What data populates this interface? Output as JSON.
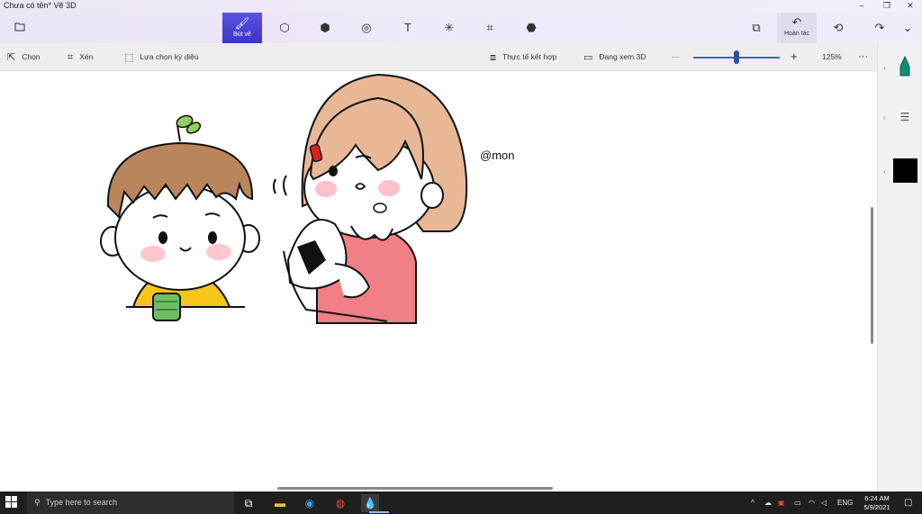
{
  "window": {
    "title": "Chưa có tên*   Vẽ 3D",
    "minimize_glyph": "–",
    "restore_glyph": "❐",
    "close_glyph": "✕"
  },
  "toolbar": {
    "menu_icon": "folder-icon",
    "tools": [
      {
        "name": "brushes",
        "label": "Bút vẽ",
        "icon": "brush-icon",
        "glyph": "🖌",
        "active": true
      },
      {
        "name": "2d-shapes",
        "icon": "shapes-2d-icon",
        "glyph": "⬡"
      },
      {
        "name": "3d-shapes",
        "icon": "cube-icon",
        "glyph": "⬢"
      },
      {
        "name": "stickers",
        "icon": "sticker-icon",
        "glyph": "◎"
      },
      {
        "name": "text",
        "icon": "text-icon",
        "glyph": "T"
      },
      {
        "name": "effects",
        "icon": "effects-icon",
        "glyph": "✳"
      },
      {
        "name": "canvas",
        "icon": "canvas-icon",
        "glyph": "⌗"
      },
      {
        "name": "3d-library",
        "icon": "3d-library-icon",
        "glyph": "⬣"
      }
    ],
    "paste_glyph": "⧉",
    "undo_label": "Hoàn tác",
    "undo_glyph": "↶",
    "history_glyph": "⟲",
    "redo_glyph": "↷",
    "more_glyph": "⌄"
  },
  "subbar": {
    "select_label": "Chọn",
    "crop_label": "Xén",
    "magic_select_label": "Lựa chọn kỳ diệu",
    "mixed_reality_label": "Thực tế kết hợp",
    "view3d_label": "Đang xem 3D",
    "zoom_minus": "—",
    "zoom_plus": "+",
    "zoom_value": "125%",
    "zoom_fraction": 0.45,
    "more": "···"
  },
  "canvas": {
    "watermark": "@mon"
  },
  "rightpanel": {
    "marker_color": "#0f8e75",
    "current_color": "#000000"
  },
  "taskbar": {
    "search_placeholder": "Type here to search",
    "language": "ENG",
    "time": "6:24 AM",
    "date": "5/9/2021"
  }
}
